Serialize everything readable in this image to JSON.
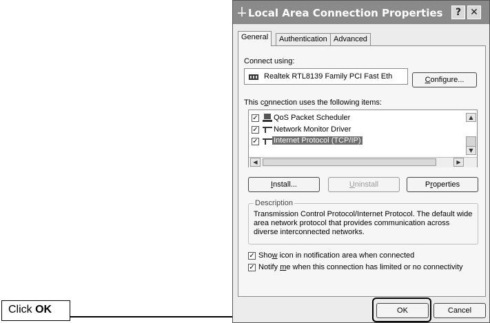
{
  "callout": {
    "prefix": "Click ",
    "bold": "OK"
  },
  "dialog": {
    "title": "Local Area Connection Properties",
    "help_glyph": "?",
    "close_glyph": "✕",
    "tabs": [
      "General",
      "Authentication",
      "Advanced"
    ],
    "connect_using_label": "Connect using:",
    "adapter_name": "Realtek RTL8139 Family PCI Fast Eth",
    "configure": "Configure...",
    "items_label": "This connection uses the following items:",
    "items": [
      {
        "label": "QoS Packet Scheduler",
        "checked": true,
        "icon": "scheduler-icon"
      },
      {
        "label": "Network Monitor Driver",
        "checked": true,
        "icon": "network-protocol-icon"
      },
      {
        "label": "Internet Protocol (TCP/IP)",
        "checked": true,
        "icon": "network-protocol-icon",
        "selected": true
      }
    ],
    "install": "Install...",
    "uninstall": "Uninstall",
    "properties": "Properties",
    "description_title": "Description",
    "description_text": "Transmission Control Protocol/Internet Protocol. The default wide area network protocol that provides communication across diverse interconnected networks.",
    "show_icon": "Show icon in notification area when connected",
    "notify": "Notify me when this connection has limited or no connectivity",
    "ok": "OK",
    "cancel": "Cancel"
  }
}
